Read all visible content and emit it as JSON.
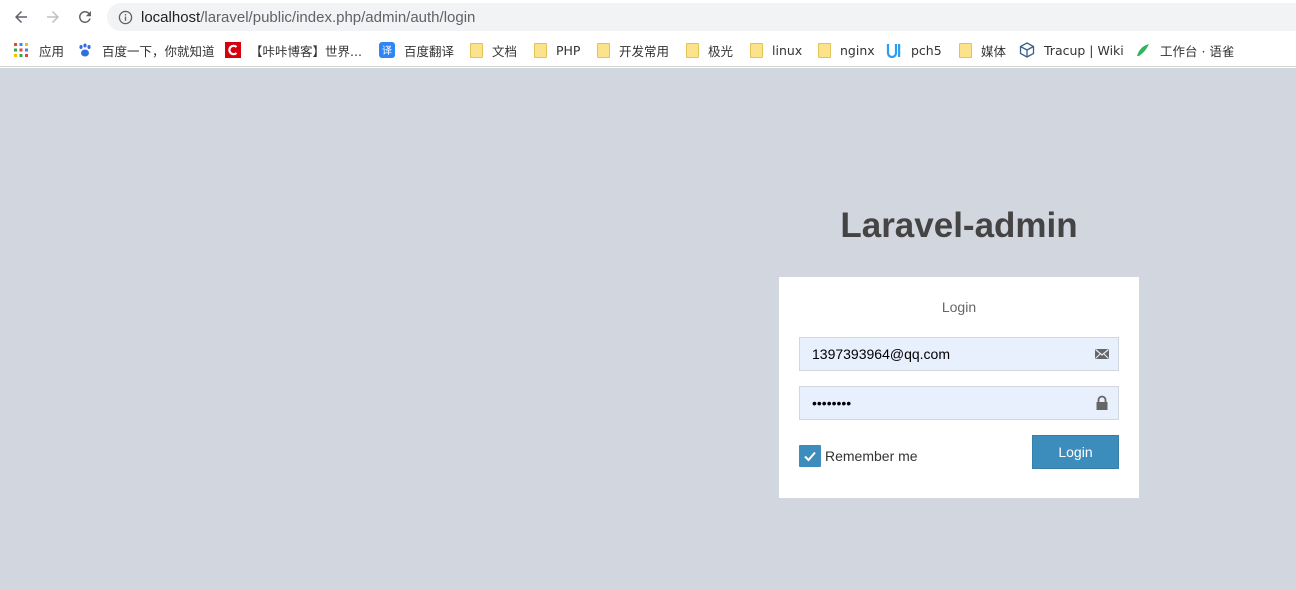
{
  "browser": {
    "url_host": "localhost",
    "url_path": "/laravel/public/index.php/admin/auth/login",
    "back_icon": "arrow-left-icon",
    "forward_icon": "arrow-right-icon",
    "reload_icon": "reload-icon",
    "info_icon": "info-circle-icon"
  },
  "bookmarks": [
    {
      "label": "应用",
      "icon": "apps-grid-icon"
    },
    {
      "label": "百度一下，你就知道",
      "icon": "baidu-paw-icon"
    },
    {
      "label": "【咔咔博客】世界...",
      "icon": "red-c-logo-icon"
    },
    {
      "label": "百度翻译",
      "icon": "translate-icon"
    },
    {
      "label": "文档",
      "icon": "folder-icon"
    },
    {
      "label": "PHP",
      "icon": "folder-icon"
    },
    {
      "label": "开发常用",
      "icon": "folder-icon"
    },
    {
      "label": "极光",
      "icon": "folder-icon"
    },
    {
      "label": "linux",
      "icon": "folder-icon"
    },
    {
      "label": "nginx",
      "icon": "folder-icon"
    },
    {
      "label": "pch5",
      "icon": "uni-logo-icon"
    },
    {
      "label": "媒体",
      "icon": "folder-icon"
    },
    {
      "label": "Tracup | Wiki",
      "icon": "cube-icon"
    },
    {
      "label": "工作台 · 语雀",
      "icon": "yuque-bird-icon"
    }
  ],
  "login": {
    "brand": "Laravel-admin",
    "box_message": "Login",
    "username_value": "1397393964@qq.com",
    "password_value": "12345678",
    "remember_label": "Remember me",
    "remember_checked": true,
    "submit_label": "Login"
  },
  "colors": {
    "page_bg": "#d2d6de",
    "primary": "#3c8dbc",
    "input_bg": "#e8f0fe",
    "brand_text": "#444444"
  }
}
